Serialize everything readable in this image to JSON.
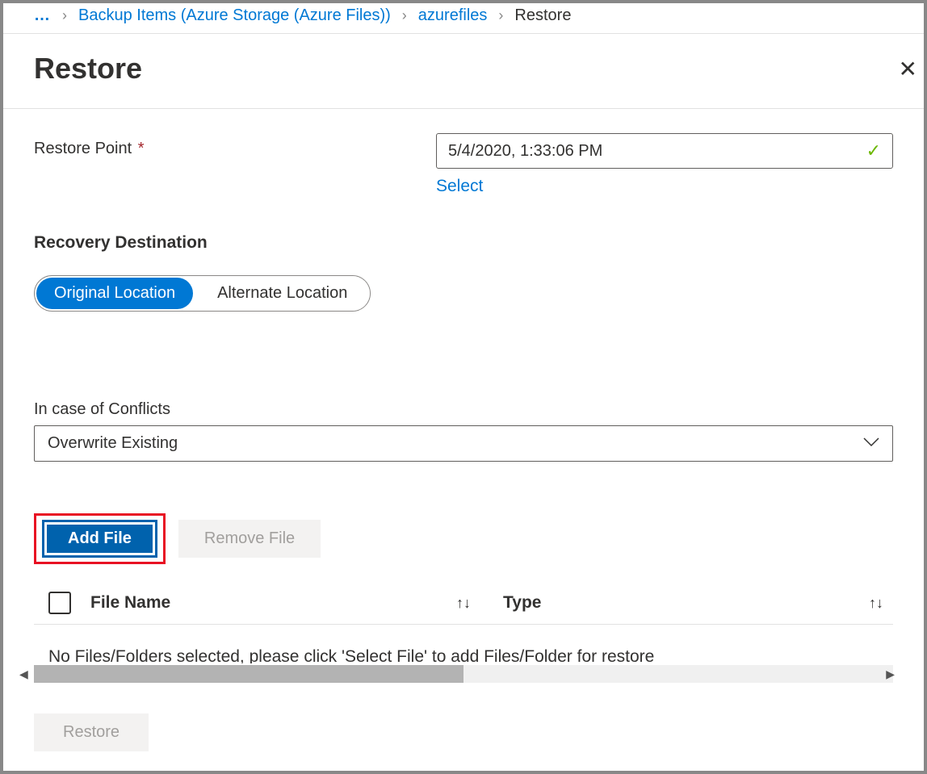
{
  "breadcrumb": {
    "dots": "…",
    "items": [
      {
        "label": "Backup Items (Azure Storage (Azure Files))",
        "link": true
      },
      {
        "label": "azurefiles",
        "link": true
      },
      {
        "label": "Restore",
        "link": false
      }
    ]
  },
  "header": {
    "title": "Restore"
  },
  "restorePoint": {
    "label": "Restore Point",
    "required": "*",
    "value": "5/4/2020, 1:33:06 PM",
    "selectLabel": "Select"
  },
  "recoveryDestination": {
    "heading": "Recovery Destination",
    "options": {
      "original": "Original Location",
      "alternate": "Alternate Location"
    }
  },
  "conflicts": {
    "label": "In case of Conflicts",
    "value": "Overwrite Existing"
  },
  "buttons": {
    "addFile": "Add File",
    "removeFile": "Remove File",
    "restore": "Restore"
  },
  "table": {
    "columns": {
      "fileName": "File Name",
      "type": "Type"
    },
    "emptyMessage": "No Files/Folders selected, please click 'Select File' to add Files/Folder for restore"
  }
}
